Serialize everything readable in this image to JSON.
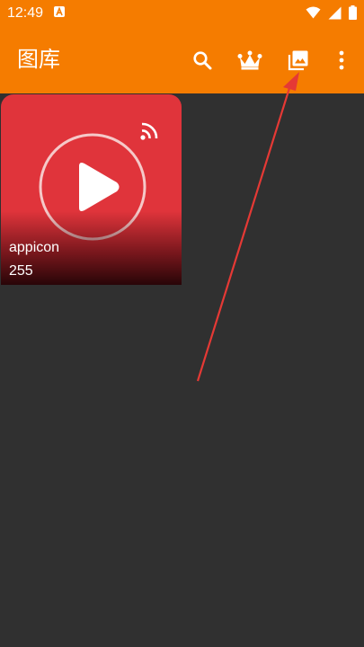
{
  "status_bar": {
    "time": "12:49",
    "notification_icon": "android-a-icon",
    "icons": [
      "wifi-icon",
      "cellular-signal-icon",
      "battery-icon"
    ]
  },
  "app_bar": {
    "title": "图库",
    "actions": [
      "search-icon",
      "crown-icon",
      "gallery-image-icon",
      "more-vert-icon"
    ]
  },
  "albums": [
    {
      "name": "appicon",
      "count": "255",
      "thumbnail_icon": "video-play-cast-icon"
    }
  ],
  "colors": {
    "primary": "#F57C00",
    "background": "#303030",
    "thumbnail": "#E0343B",
    "annotation_arrow": "#E53935"
  }
}
